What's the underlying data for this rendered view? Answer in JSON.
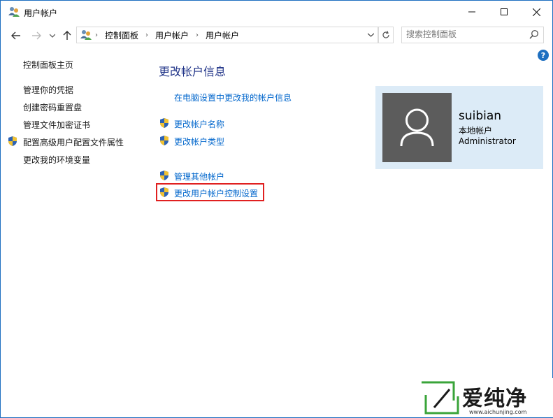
{
  "window": {
    "title": "用户帐户"
  },
  "address": {
    "crumbs": [
      "控制面板",
      "用户帐户",
      "用户帐户"
    ]
  },
  "search": {
    "placeholder": "搜索控制面板"
  },
  "help": {
    "glyph": "?"
  },
  "sidebar": {
    "items": [
      {
        "label": "控制面板主页",
        "shield": false
      },
      {
        "label": "管理你的凭据",
        "shield": false
      },
      {
        "label": "创建密码重置盘",
        "shield": false
      },
      {
        "label": "管理文件加密证书",
        "shield": false
      },
      {
        "label": "配置高级用户配置文件属性",
        "shield": true
      },
      {
        "label": "更改我的环境变量",
        "shield": false
      }
    ]
  },
  "main": {
    "title": "更改帐户信息",
    "pc_settings_link": "在电脑设置中更改我的帐户信息",
    "links": [
      {
        "label": "更改帐户名称"
      },
      {
        "label": "更改帐户类型"
      },
      {
        "label": "管理其他帐户"
      },
      {
        "label": "更改用户帐户控制设置"
      }
    ]
  },
  "user": {
    "name": "suibian",
    "type": "本地帐户",
    "role": "Administrator"
  },
  "watermark": {
    "text": "爱纯净",
    "url": "www.aichunjing.com"
  },
  "colors": {
    "accent": "#1e6fc0",
    "link": "#0066cc",
    "title": "#1e3287",
    "card": "#dcebf7",
    "highlight": "#e02020"
  }
}
